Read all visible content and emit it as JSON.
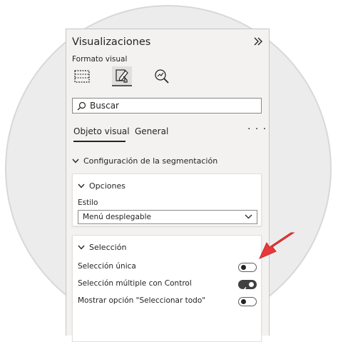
{
  "panel": {
    "title": "Visualizaciones",
    "subtitle": "Formato visual",
    "search": {
      "placeholder": "Buscar"
    },
    "tabs": [
      {
        "label": "Objeto visual",
        "active": true
      },
      {
        "label": "General",
        "active": false
      }
    ],
    "section": {
      "label": "Configuración de la segmentación"
    },
    "options_card": {
      "header": "Opciones",
      "style_label": "Estilo",
      "style_value": "Menú desplegable"
    },
    "selection_card": {
      "header": "Selección",
      "rows": [
        {
          "label": "Selección única",
          "toggle": false
        },
        {
          "label": "Selección múltiple con Control",
          "toggle": true
        },
        {
          "label": "Mostrar opción \"Seleccionar todo\"",
          "toggle": false
        }
      ]
    }
  },
  "icons": {
    "collapse": "double-chevron-right-icon",
    "format_build": "build-visual-icon",
    "format_visual": "format-visual-icon",
    "analytics": "analytics-icon",
    "search": "search-icon",
    "more": "more-options-icon"
  },
  "colors": {
    "panel_bg": "#f3f2f1",
    "card_bg": "#ffffff",
    "toggle_on": "#404040",
    "arrow": "#e8383a"
  }
}
